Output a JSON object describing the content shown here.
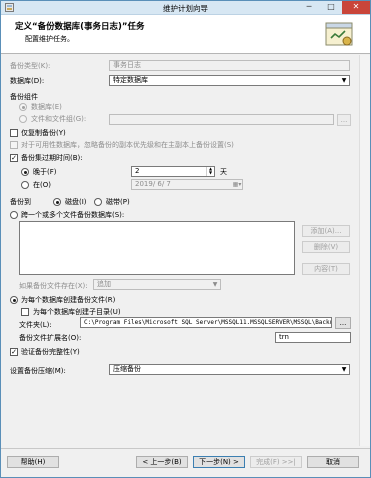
{
  "window": {
    "title": "维护计划向导",
    "minimize_glyph": "─",
    "maximize_glyph": "□",
    "close_glyph": "✕"
  },
  "header": {
    "title": "定义“备份数据库(事务日志)”任务",
    "subtitle": "配置维护任务。"
  },
  "form": {
    "backup_type_label": "备份类型(K):",
    "backup_type_value": "事务日志",
    "database_label": "数据库(D):",
    "database_value": "特定数据库",
    "backup_component_label": "备份组件",
    "database_option": "数据库(E)",
    "files_option": "文件和文件组(G):",
    "browse_label": "...",
    "copy_only_label": "仅复制备份(Y)",
    "secondary_priority_label": "对于可用性数据库，忽略备份的副本优先级和在主副本上备份设置(S)",
    "expire_label": "备份集过期时间(B):",
    "after_label": "晚于(F)",
    "after_value": "2",
    "days_label": "天",
    "on_label": "在(O)",
    "on_value": "2019/ 6/ 7",
    "backup_to_label": "备份到",
    "disk_label": "磁盘(I)",
    "tape_label": "磁带(P)",
    "span_files_label": "跨一个或多个文件备份数据库(S):",
    "add_button": "添加(A)...",
    "remove_button": "删除(V)",
    "contents_button": "内容(T)",
    "if_exists_label": "如果备份文件存在(X):",
    "if_exists_value": "追加",
    "per_db_file_label": "为每个数据库创建备份文件(R)",
    "per_db_subdir_label": "为每个数据库创建子目录(U)",
    "folder_label": "文件夹(L):",
    "folder_value": "C:\\Program Files\\Microsoft SQL Server\\MSSQL11.MSSQLSERVER\\MSSQL\\Backup",
    "folder_browse": "...",
    "extension_label": "备份文件扩展名(O):",
    "extension_value": "trn",
    "verify_label": "验证备份完整性(Y)",
    "compression_label": "设置备份压缩(M):",
    "compression_value": "压缩备份",
    "check_mark": "✓"
  },
  "footer": {
    "help_button": "帮助(H)",
    "back_button": "< 上一步(B)",
    "next_button": "下一步(N) >",
    "finish_button": "完成(F) >>|",
    "cancel_button": "取消"
  },
  "colors": {
    "accent": "#3c7fb1",
    "title_bar": "#d7e7f3",
    "close_button": "#c9453a"
  }
}
